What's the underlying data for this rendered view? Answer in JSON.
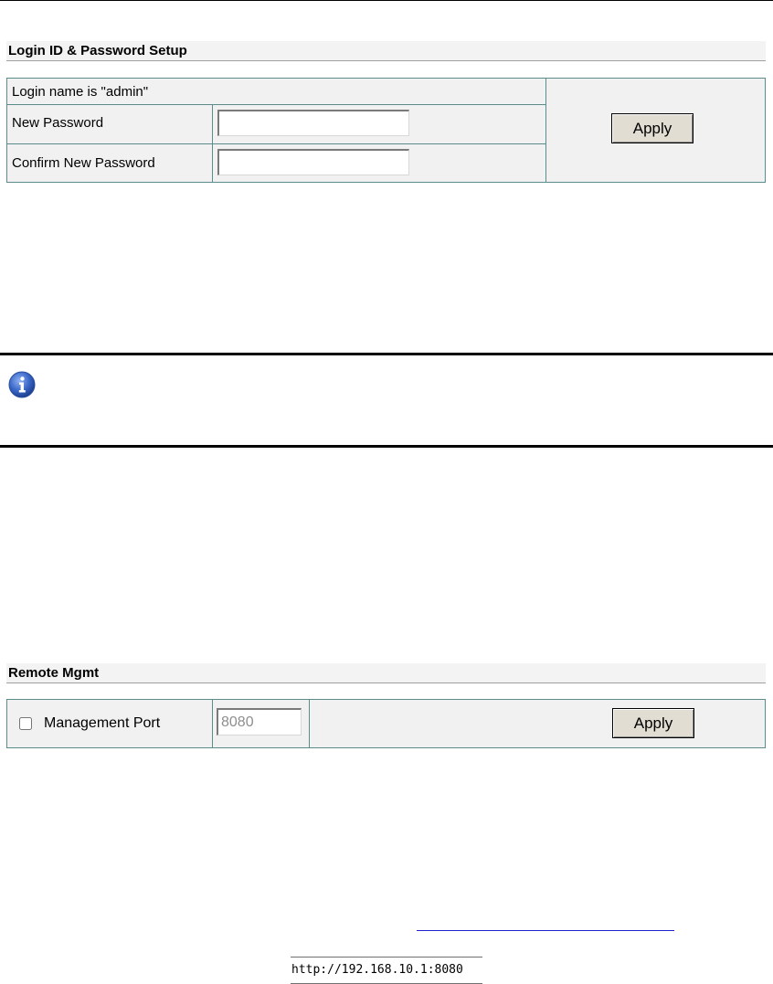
{
  "login_setup": {
    "title": "Login ID & Password Setup",
    "login_name_text": "Login name is \"admin\"",
    "new_password_label": "New Password",
    "new_password_value": "",
    "confirm_password_label": "Confirm New Password",
    "confirm_password_value": "",
    "apply_label": "Apply"
  },
  "info_note": {
    "icon": "info-icon",
    "icon_color": "#3a67c8"
  },
  "remote_mgmt": {
    "title": "Remote Mgmt",
    "checkbox_checked": false,
    "management_port_label": "Management Port",
    "port_value": "8080",
    "apply_label": "Apply"
  },
  "footer": {
    "url_text": "http://192.168.10.1:8080"
  },
  "colors": {
    "panel_bg": "#f1f1f1",
    "panel_border": "#5b8c8c",
    "button_bg": "#e2ddd2",
    "link": "#2222cc"
  }
}
